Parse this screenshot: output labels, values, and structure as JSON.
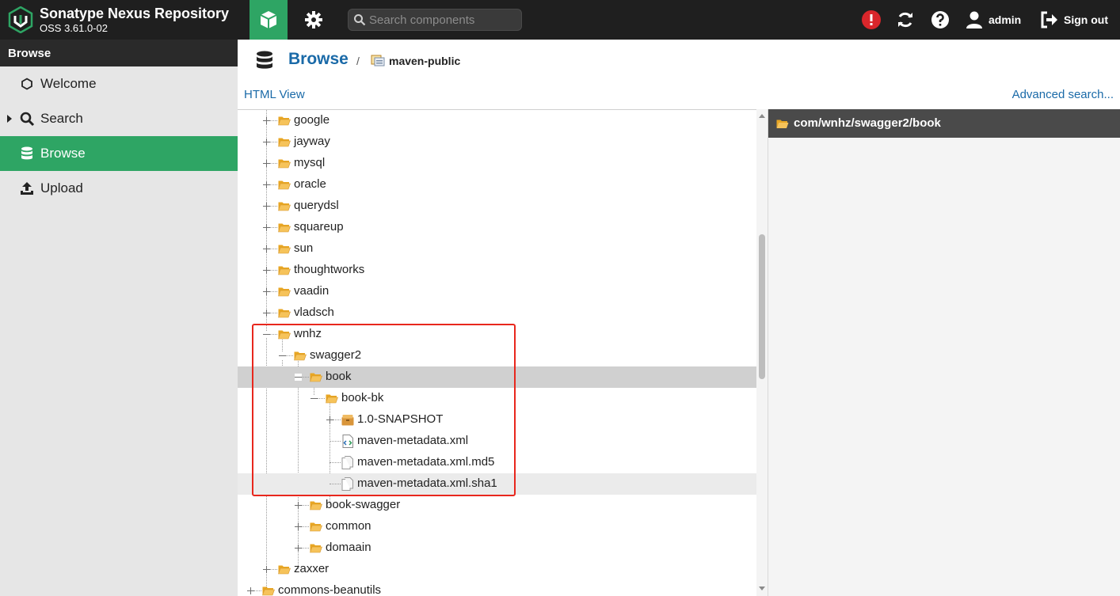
{
  "app": {
    "name": "Sonatype Nexus Repository",
    "version": "OSS 3.61.0-02"
  },
  "header": {
    "search_placeholder": "Search components",
    "user_label": "admin",
    "signout_label": "Sign out"
  },
  "sidebar": {
    "title": "Browse",
    "items": [
      {
        "label": "Welcome",
        "icon": "hexagon-icon"
      },
      {
        "label": "Search",
        "icon": "search-icon"
      },
      {
        "label": "Browse",
        "icon": "database-icon"
      },
      {
        "label": "Upload",
        "icon": "upload-icon"
      }
    ]
  },
  "breadcrumb": {
    "section": "Browse",
    "separator": "/",
    "repository": "maven-public"
  },
  "links": {
    "html_view": "HTML View",
    "advanced_search": "Advanced search..."
  },
  "detail": {
    "path": "com/wnhz/swagger2/book"
  },
  "colors": {
    "accent": "#2ea564",
    "link": "#1a6aa8",
    "highlight": "#e8271d",
    "folder": "#f0b43c"
  },
  "tree": [
    {
      "label": "google",
      "type": "folder"
    },
    {
      "label": "jayway",
      "type": "folder"
    },
    {
      "label": "mysql",
      "type": "folder"
    },
    {
      "label": "oracle",
      "type": "folder"
    },
    {
      "label": "querydsl",
      "type": "folder"
    },
    {
      "label": "squareup",
      "type": "folder"
    },
    {
      "label": "sun",
      "type": "folder"
    },
    {
      "label": "thoughtworks",
      "type": "folder"
    },
    {
      "label": "vaadin",
      "type": "folder"
    },
    {
      "label": "vladsch",
      "type": "folder"
    },
    {
      "label": "wnhz",
      "type": "folder"
    },
    {
      "label": "swagger2",
      "type": "folder"
    },
    {
      "label": "book",
      "type": "folder"
    },
    {
      "label": "book-bk",
      "type": "folder"
    },
    {
      "label": "1.0-SNAPSHOT",
      "type": "component"
    },
    {
      "label": "maven-metadata.xml",
      "type": "xml-file"
    },
    {
      "label": "maven-metadata.xml.md5",
      "type": "file"
    },
    {
      "label": "maven-metadata.xml.sha1",
      "type": "file"
    },
    {
      "label": "book-swagger",
      "type": "folder"
    },
    {
      "label": "common",
      "type": "folder"
    },
    {
      "label": "domaain",
      "type": "folder"
    },
    {
      "label": "zaxxer",
      "type": "folder"
    },
    {
      "label": "commons-beanutils",
      "type": "folder"
    }
  ]
}
